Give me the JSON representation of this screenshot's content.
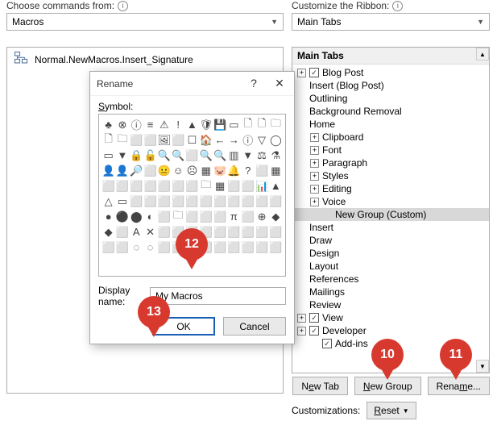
{
  "left": {
    "choose_label": "Choose commands from:",
    "choose_value": "Macros",
    "macro_item": "Normal.NewMacros.Insert_Signature"
  },
  "right": {
    "customize_label": "Customize the Ribbon:",
    "customize_value": "Main Tabs",
    "tree_header": "Main Tabs",
    "tree": [
      {
        "indent": 0,
        "exp": "+",
        "chk": true,
        "label": "Blog Post"
      },
      {
        "indent": 0,
        "exp": "",
        "chk": null,
        "label": "Insert (Blog Post)"
      },
      {
        "indent": 0,
        "exp": "",
        "chk": null,
        "label": "Outlining"
      },
      {
        "indent": 0,
        "exp": "",
        "chk": null,
        "label": "Background Removal"
      },
      {
        "indent": 0,
        "exp": "",
        "chk": null,
        "label": "Home"
      },
      {
        "indent": 1,
        "exp": "+",
        "chk": null,
        "label": "Clipboard"
      },
      {
        "indent": 1,
        "exp": "+",
        "chk": null,
        "label": "Font"
      },
      {
        "indent": 1,
        "exp": "+",
        "chk": null,
        "label": "Paragraph"
      },
      {
        "indent": 1,
        "exp": "+",
        "chk": null,
        "label": "Styles"
      },
      {
        "indent": 1,
        "exp": "+",
        "chk": null,
        "label": "Editing"
      },
      {
        "indent": 1,
        "exp": "+",
        "chk": null,
        "label": "Voice"
      },
      {
        "indent": 2,
        "exp": "",
        "chk": null,
        "label": "New Group (Custom)",
        "selected": true
      },
      {
        "indent": 0,
        "exp": "",
        "chk": null,
        "label": "Insert"
      },
      {
        "indent": 0,
        "exp": "",
        "chk": null,
        "label": "Draw"
      },
      {
        "indent": 0,
        "exp": "",
        "chk": null,
        "label": "Design"
      },
      {
        "indent": 0,
        "exp": "",
        "chk": null,
        "label": "Layout"
      },
      {
        "indent": 0,
        "exp": "",
        "chk": null,
        "label": "References"
      },
      {
        "indent": 0,
        "exp": "",
        "chk": null,
        "label": "Mailings"
      },
      {
        "indent": 0,
        "exp": "",
        "chk": null,
        "label": "Review"
      },
      {
        "indent": 0,
        "exp": "+",
        "chk": true,
        "label": "View"
      },
      {
        "indent": 0,
        "exp": "+",
        "chk": true,
        "label": "Developer"
      },
      {
        "indent": 1,
        "exp": "",
        "chk": true,
        "label": "Add-ins"
      }
    ],
    "buttons": {
      "new_tab": "New Tab",
      "new_group": "New Group",
      "rename": "Rename..."
    },
    "customizations_label": "Customizations:",
    "reset_label": "Reset"
  },
  "dialog": {
    "title": "Rename",
    "symbol_label": "Symbol:",
    "display_label": "Display name:",
    "display_value": "My Macros",
    "ok": "OK",
    "cancel": "Cancel",
    "symbols": [
      "♣",
      "⊗",
      "ⓘ",
      "≡",
      "⚠",
      "!",
      "▲",
      "🛡",
      "💾",
      "▭",
      "🗋",
      "🗋",
      "🗀",
      "🗋",
      "🗀",
      "⬜",
      "⬜",
      "🖼",
      "⬜",
      "☐",
      "🏠",
      "←",
      "→",
      "ⓘ",
      "▽",
      "◯",
      "▭",
      "▼",
      "🔒",
      "🔓",
      "🔍",
      "🔍",
      "⬜",
      "🔍",
      "🔍",
      "▥",
      "▼",
      "⚖",
      "⚗",
      "👤",
      "👤",
      "🔎",
      "⬜",
      "😐",
      "☺",
      "☹",
      "▦",
      "🐷",
      "🔔",
      "?",
      "⬜",
      "▦",
      "⬜",
      "⬜",
      "⬜",
      "⬜",
      "⬜",
      "⬜",
      "⬜",
      "🗀",
      "▦",
      "⬜",
      "⬜",
      "📊",
      "▲",
      "△",
      "▭",
      "⬜",
      "⬜",
      "⬜",
      "⬜",
      "⬜",
      "⬜",
      "⬜",
      "⬜",
      "⬜",
      "⬜",
      "⬜",
      "●",
      "⚫",
      "⬤",
      "◐",
      "⬜",
      "🗀",
      "⬜",
      "⬜",
      "⬜",
      "π",
      "⬜",
      "⊕",
      "◆",
      "◆",
      "⬜",
      "A",
      "✕",
      "⬜",
      "⬜",
      "⬜",
      "⬜",
      "⬜",
      "⬜",
      "⬜",
      "⬜",
      "⬜",
      "⬜",
      "⬜",
      "◌",
      "◌",
      "⬜",
      "⬜",
      "🦋",
      "⬜",
      "⬜",
      "⬜",
      "⬜",
      "⬜",
      "⬜"
    ]
  },
  "balloons": {
    "b10": "10",
    "b11": "11",
    "b12": "12",
    "b13": "13"
  }
}
